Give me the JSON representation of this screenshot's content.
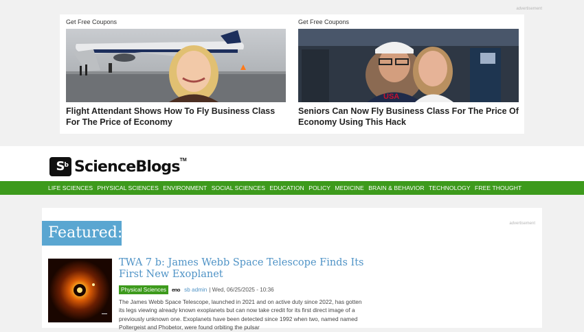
{
  "top_ad": {
    "label": "advertisement",
    "cards": [
      {
        "kicker": "Get Free Coupons",
        "headline": "Flight Attendant Shows How To Fly Business Class For The Price of Economy"
      },
      {
        "kicker": "Get Free Coupons",
        "headline": "Seniors Can Now Fly Business Class For The Price Of Economy Using This Hack"
      }
    ]
  },
  "site": {
    "logo_mark": "S",
    "logo_mark_sup": "b",
    "logo_word": "ScienceBlogs",
    "logo_tm": "TM"
  },
  "nav": {
    "items": [
      "LIFE SCIENCES",
      "PHYSICAL SCIENCES",
      "ENVIRONMENT",
      "SOCIAL SCIENCES",
      "EDUCATION",
      "POLICY",
      "MEDICINE",
      "BRAIN & BEHAVIOR",
      "TECHNOLOGY",
      "FREE THOUGHT"
    ]
  },
  "main": {
    "featured_label": "Featured:",
    "ad_label": "advertisement",
    "article": {
      "title": "TWA 7 b: James Webb Space Telescope Finds Its First New Exoplanet",
      "category": "Physical Sciences",
      "source_badge": "eno",
      "author": "sb admin",
      "date": "| Wed, 06/25/2025 - 10:36",
      "excerpt": "The James Webb Space Telescope, launched in 2021 and on active duty since 2022, has gotten its legs viewing already known exoplanets but can now take credit for its first direct image of a previously unknown one.  Exoplanets have been detected since 1992 when two, named named Poltergeist and Phobetor, were found orbiting the pulsar"
    }
  }
}
